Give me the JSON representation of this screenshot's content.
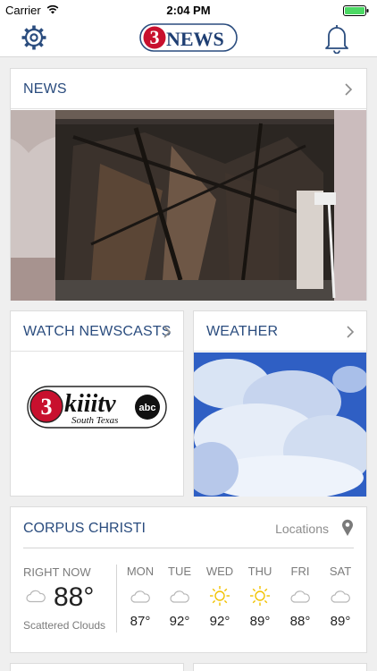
{
  "status": {
    "carrier": "Carrier",
    "time": "2:04 PM"
  },
  "nav": {
    "logo": "NEWS",
    "logo_number": "3"
  },
  "news": {
    "title": "NEWS"
  },
  "newscasts": {
    "title": "WATCH NEWSCASTS",
    "logo_text": "kiiitv",
    "logo_sub": "South Texas",
    "logo_net": "abc",
    "logo_number": "3"
  },
  "weather": {
    "title": "WEATHER"
  },
  "city": {
    "name": "CORPUS CHRISTI",
    "locations_label": "Locations",
    "right_now": {
      "label": "RIGHT NOW",
      "temp": "88°",
      "condition": "Scattered Clouds",
      "icon": "cloud-icon"
    },
    "forecast": [
      {
        "day": "MON",
        "temp": "87°",
        "icon": "cloud-icon"
      },
      {
        "day": "TUE",
        "temp": "92°",
        "icon": "cloud-icon"
      },
      {
        "day": "WED",
        "temp": "92°",
        "icon": "sun-icon"
      },
      {
        "day": "THU",
        "temp": "89°",
        "icon": "sun-icon"
      },
      {
        "day": "FRI",
        "temp": "88°",
        "icon": "cloud-icon"
      },
      {
        "day": "SAT",
        "temp": "89°",
        "icon": "cloud-icon"
      }
    ]
  },
  "colors": {
    "accent": "#2a4c7e",
    "logo_red": "#c8102e",
    "sun": "#f2c200"
  }
}
